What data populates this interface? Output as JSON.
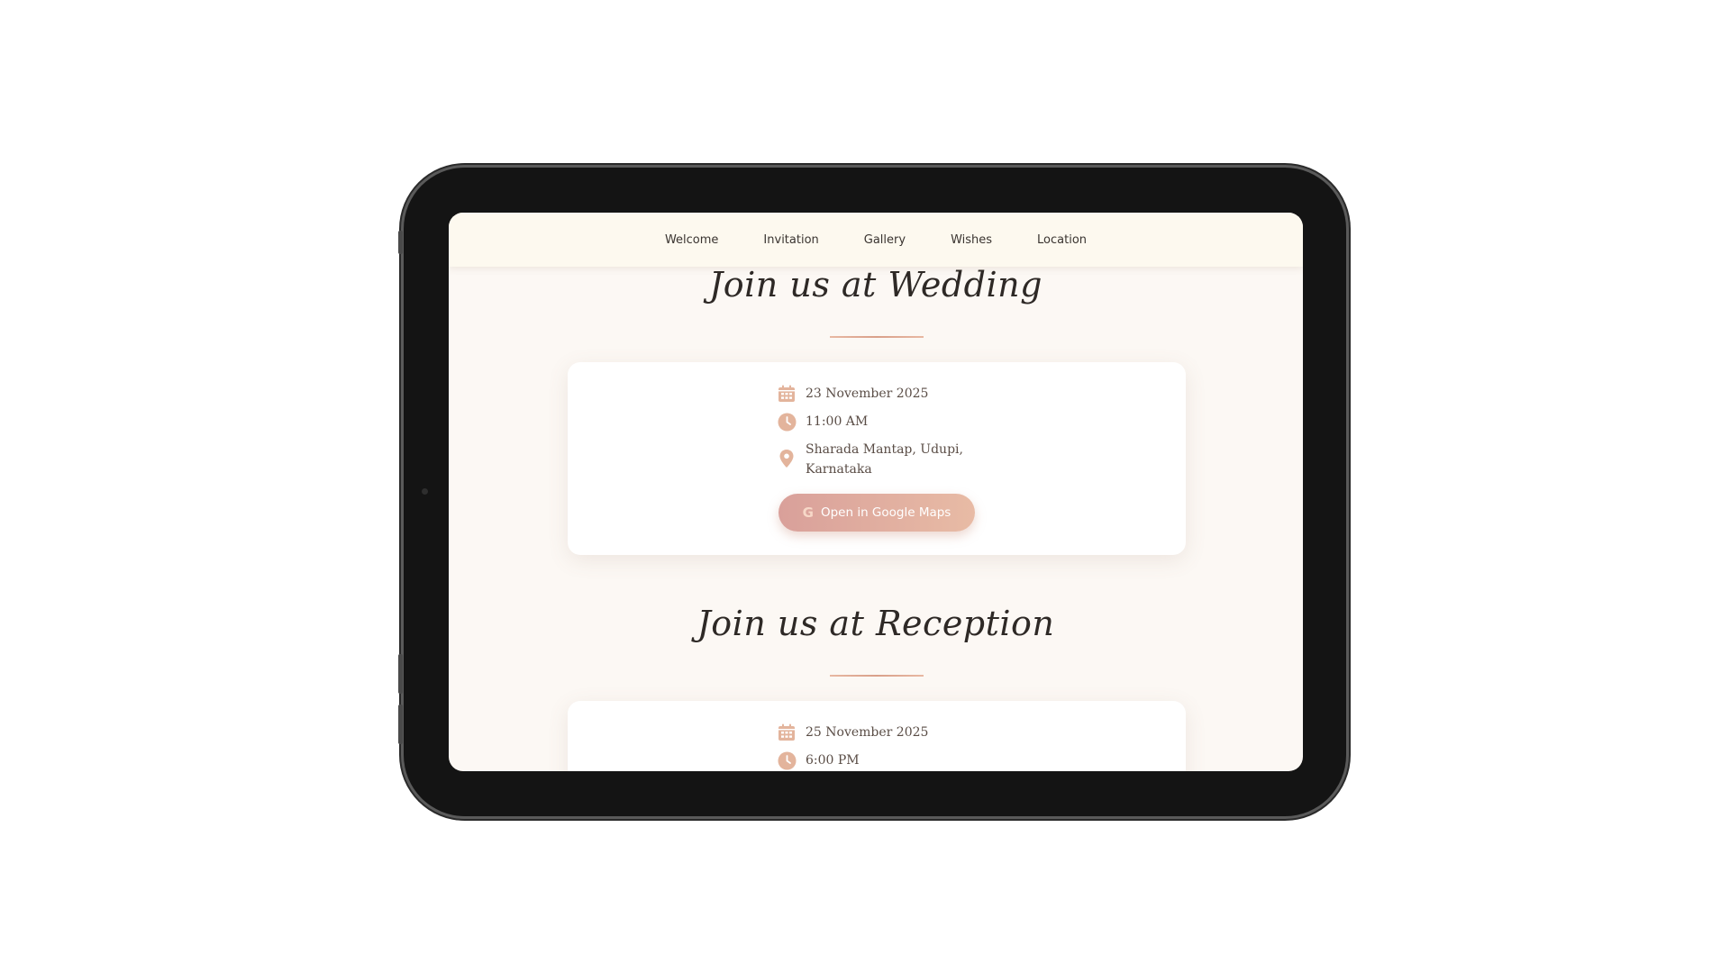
{
  "nav": {
    "items": [
      {
        "label": "Welcome"
      },
      {
        "label": "Invitation"
      },
      {
        "label": "Gallery"
      },
      {
        "label": "Wishes"
      },
      {
        "label": "Location"
      }
    ]
  },
  "wedding": {
    "title": "Join us at Wedding",
    "date": "23 November 2025",
    "time": "11:00 AM",
    "venue_line1": "Sharada Mantap, Udupi,",
    "venue_line2": "Karnataka",
    "maps_icon": "G",
    "maps_label": "Open in Google Maps"
  },
  "reception": {
    "title": "Join us at Reception",
    "date": "25 November 2025",
    "time": "6:00 PM"
  },
  "colors": {
    "accent": "#e3b49c",
    "button_start": "#d9a09a",
    "button_end": "#e8bba5",
    "page_bg": "#fcf8f4",
    "nav_bg": "#fdf9ef"
  },
  "icons": {
    "date": "calendar-icon",
    "time": "clock-icon",
    "venue": "map-pin-icon",
    "maps": "google-icon"
  }
}
